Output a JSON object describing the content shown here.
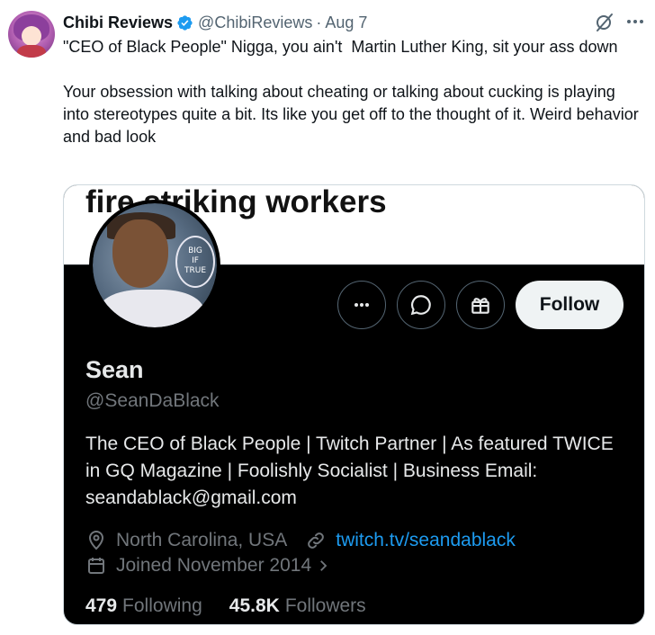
{
  "tweet": {
    "author_name": "Chibi Reviews",
    "author_handle": "@ChibiReviews",
    "separator": "·",
    "date": "Aug 7",
    "text": "\"CEO of Black People\" Nigga, you ain't  Martin Luther King, sit your ass down\n\nYour obsession with talking about cheating or talking about cucking is playing into stereotypes quite a bit. Its like you get off to the thought of it. Weird behavior and bad look",
    "icons": {
      "verified": "verified-badge-icon",
      "grok": "grok-icon",
      "more": "more-icon"
    },
    "colors": {
      "verified": "#1d9bf0",
      "secondary_text": "#536471"
    }
  },
  "card": {
    "banner_text": "announced it would permanently\nfire striking workers",
    "avatar_caption": "BIG\nIF\nTRUE",
    "profile": {
      "name": "Sean",
      "handle": "@SeanDaBlack",
      "bio": "The CEO of Black People | Twitch Partner | As featured TWICE in GQ Magazine | Foolishly Socialist | Business Email: seandablack@gmail.com",
      "location": "North Carolina, USA",
      "website": "twitch.tv/seandablack",
      "joined": "Joined November 2014",
      "following_count": "479",
      "following_label": "Following",
      "followers_count": "45.8K",
      "followers_label": "Followers"
    },
    "buttons": {
      "follow_label": "Follow",
      "icons": [
        "more-icon",
        "message-icon",
        "gift-icon"
      ]
    },
    "colors": {
      "background": "#000000",
      "link": "#1d9bf0",
      "muted": "#71767b",
      "follow_bg": "#eff3f4"
    }
  }
}
